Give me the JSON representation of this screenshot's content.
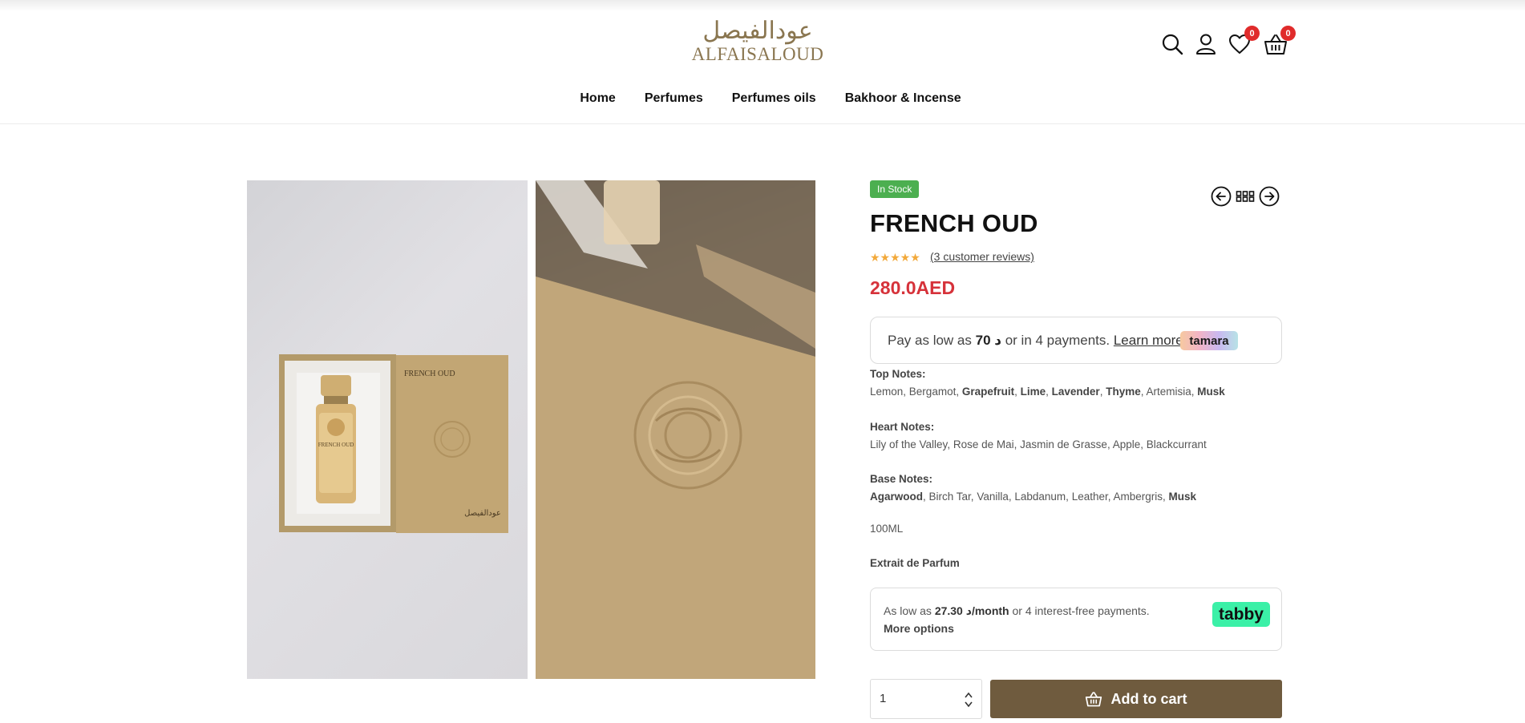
{
  "brand": {
    "logo_arabic": "عودالفيصل",
    "logo_english": "ALFAISALOUD"
  },
  "header_icons": [
    {
      "icon": "search-icon"
    },
    {
      "icon": "user-icon"
    },
    {
      "icon": "heart-icon",
      "badge": "0"
    },
    {
      "icon": "basket-icon",
      "badge": "0"
    }
  ],
  "nav": {
    "items": [
      "Home",
      "Perfumes",
      "Perfumes oils",
      "Bakhoor & Incense"
    ]
  },
  "product": {
    "stock_label": "In Stock",
    "title": "FRENCH OUD",
    "rating_stars": "★★★★★",
    "rating": 5,
    "reviews_label": "(3 customer reviews)",
    "price": "280.0AED"
  },
  "tamara": {
    "prefix": "Pay as low as ",
    "amount": "د 70",
    "suffix": " or in 4 payments. ",
    "learn_more": "Learn more",
    "logo": "tamara"
  },
  "notes": {
    "top_label": "Top Notes:",
    "top_values": [
      {
        "text": "Lemon",
        "bold": false
      },
      {
        "text": "Bergamot",
        "bold": false
      },
      {
        "text": "Grapefruit",
        "bold": true
      },
      {
        "text": "Lime",
        "bold": true
      },
      {
        "text": "Lavender",
        "bold": true
      },
      {
        "text": "Thyme",
        "bold": true
      },
      {
        "text": "Artemisia",
        "bold": false
      },
      {
        "text": "Musk",
        "bold": true
      }
    ],
    "heart_label": "Heart Notes:",
    "heart_values": [
      {
        "text": "Lily of the Valley",
        "bold": false
      },
      {
        "text": "Rose de Mai",
        "bold": false
      },
      {
        "text": "Jasmin de Grasse",
        "bold": false
      },
      {
        "text": "Apple",
        "bold": false
      },
      {
        "text": "Blackcurrant",
        "bold": false
      }
    ],
    "base_label": "Base Notes:",
    "base_values": [
      {
        "text": "Agarwood",
        "bold": true
      },
      {
        "text": "Birch Tar",
        "bold": false
      },
      {
        "text": "Vanilla",
        "bold": false
      },
      {
        "text": "Labdanum",
        "bold": false
      },
      {
        "text": "Leather",
        "bold": false
      },
      {
        "text": "Ambergris",
        "bold": false
      },
      {
        "text": "Musk",
        "bold": true
      }
    ],
    "volume": "100ML",
    "concentration": "Extrait de Parfum"
  },
  "tabby": {
    "prefix": "As low as ",
    "amount": "د 27.30",
    "per": "/month",
    "suffix": " or 4 interest-free payments.",
    "more_options": "More options",
    "logo": "tabby"
  },
  "cart": {
    "quantity": "1",
    "add_label": "Add to cart"
  },
  "colors": {
    "accent": "#6f5b3e",
    "price": "#d6323a",
    "stock": "#4caf50",
    "badge": "#e02b2b",
    "logo": "#8a7650"
  }
}
